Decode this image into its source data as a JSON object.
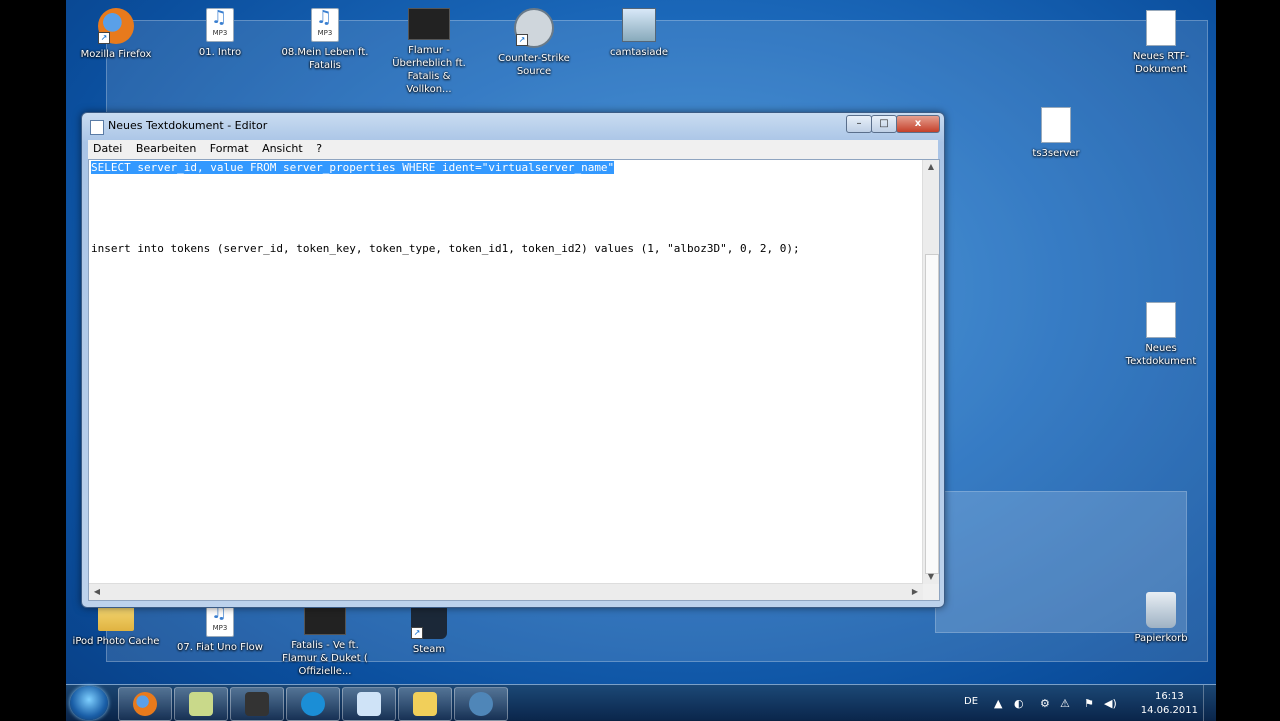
{
  "desktop": {
    "icons": [
      {
        "label": "Mozilla Firefox",
        "icon": "firefox-icon"
      },
      {
        "label": "01. Intro",
        "icon": "mp3-file-icon",
        "badge": "MP3"
      },
      {
        "label": "08.Mein Leben ft. Fatalis",
        "icon": "mp3-file-icon",
        "badge": "MP3"
      },
      {
        "label": "Flamur - Überheblich ft. Fatalis & Vollkon...",
        "icon": "video-file-icon"
      },
      {
        "label": "Counter-Strike Source",
        "icon": "counter-strike-icon"
      },
      {
        "label": "camtasiade",
        "icon": "installer-icon"
      },
      {
        "label": "Neues RTF-Dokument",
        "icon": "rtf-document-icon"
      },
      {
        "label": "ts3server",
        "icon": "config-file-icon"
      },
      {
        "label": "Neues Textdokument",
        "icon": "text-document-icon"
      },
      {
        "label": "iPod Photo Cache",
        "icon": "folder-icon"
      },
      {
        "label": "07. Fiat Uno Flow",
        "icon": "mp3-file-icon",
        "badge": "MP3"
      },
      {
        "label": "Fatalis - Ve ft. Flamur & Duket ( Offizielle...",
        "icon": "video-file-icon"
      },
      {
        "label": "Steam",
        "icon": "steam-icon"
      },
      {
        "label": "Papierkorb",
        "icon": "recycle-bin-icon"
      }
    ]
  },
  "notepad": {
    "title": "Neues Textdokument - Editor",
    "menu": [
      "Datei",
      "Bearbeiten",
      "Format",
      "Ansicht",
      "?"
    ],
    "lines": [
      "SELECT server_id, value FROM server_properties WHERE ident=\"virtualserver_name\"",
      "insert into tokens (server_id, token_key, token_type, token_id1, token_id2) values (1, \"alboz3D\", 0, 2, 0);"
    ],
    "buttons": {
      "minimize": "–",
      "maximize": "□",
      "close": "x"
    }
  },
  "taskbar": {
    "language": "DE",
    "time": "16:13",
    "date": "14.06.2011",
    "apps": [
      "start-orb-icon",
      "firefox-icon",
      "notes-icon",
      "media-icon",
      "skype-icon",
      "notepad-icon",
      "explorer-icon",
      "teamspeak-icon"
    ]
  }
}
